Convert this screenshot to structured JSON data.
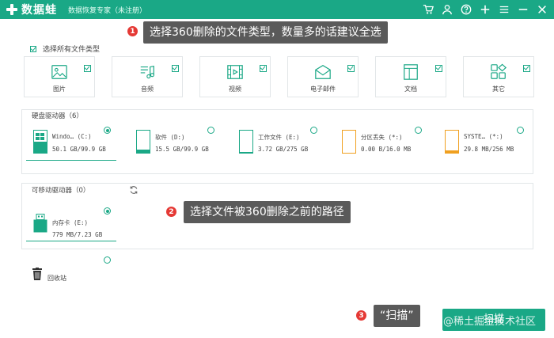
{
  "app": {
    "logo_text": "数据蛙",
    "subtitle": "数据恢复专家（未注册）"
  },
  "title_icons": [
    "cart-icon",
    "user-icon",
    "help-icon",
    "plus-icon",
    "menu-icon",
    "minimize-icon",
    "close-icon"
  ],
  "callouts": [
    {
      "number": "1",
      "text": "选择360删除的文件类型，数量多的话建议全选"
    },
    {
      "number": "2",
      "text": "选择文件被360删除之前的路径"
    },
    {
      "number": "3",
      "text": "“扫描”"
    }
  ],
  "file_types": {
    "select_all_label": "选择所有文件类型",
    "items": [
      {
        "label": "图片",
        "icon": "image-icon",
        "checked": true
      },
      {
        "label": "音频",
        "icon": "audio-icon",
        "checked": true
      },
      {
        "label": "视频",
        "icon": "video-icon",
        "checked": true
      },
      {
        "label": "电子邮件",
        "icon": "email-icon",
        "checked": true
      },
      {
        "label": "文档",
        "icon": "document-icon",
        "checked": true
      },
      {
        "label": "其它",
        "icon": "other-icon",
        "checked": true
      }
    ]
  },
  "hard_drives": {
    "title": "硬盘驱动器（6）",
    "items": [
      {
        "name": "Windo… (C:)",
        "size": "50.1 GB/99.9 GB",
        "selected": true,
        "fill": 0.5
      },
      {
        "name": "软件 (D:)",
        "size": "15.5 GB/99.9 GB",
        "selected": false,
        "fill": 0.16
      },
      {
        "name": "工作文件 (E:)",
        "size": "3.72 GB/275 GB",
        "selected": false,
        "fill": 0.01
      },
      {
        "name": "分区丢失 (*:)",
        "size": "0.00  B/16.0 MB",
        "selected": false,
        "fill": 0
      },
      {
        "name": "SYSTE… (*:)",
        "size": "29.8 MB/256 MB",
        "selected": false,
        "fill": 0.12
      }
    ]
  },
  "removable_drives": {
    "title": "可移动驱动器（0）",
    "items": [
      {
        "name": "内存卡 (E:)",
        "size": "779 MB/7.23 GB",
        "selected": true
      }
    ]
  },
  "recycle_bin": {
    "label": "回收站",
    "selected": false
  },
  "scan_button": {
    "label": "扫描"
  },
  "watermark": "@稀土掘金技术社区",
  "colors": {
    "accent": "#1aa886",
    "callout_bg": "#5a5a5a",
    "marker": "#e53935",
    "drive_orange": "#f0a020"
  }
}
